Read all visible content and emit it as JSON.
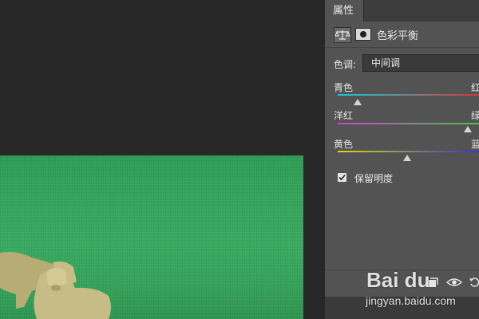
{
  "panel": {
    "tab_label": "属性",
    "title": "色彩平衡",
    "tone": {
      "label": "色调:",
      "value": "中间调"
    },
    "sliders": [
      {
        "left_label": "青色",
        "right_label": "红",
        "value": 0.13,
        "gradient": [
          "#18c8d8",
          "#d83030"
        ]
      },
      {
        "left_label": "洋红",
        "right_label": "绿",
        "value": 0.86,
        "gradient": [
          "#d83cd8",
          "#3ad03a"
        ]
      },
      {
        "left_label": "黄色",
        "right_label": "蓝",
        "value": 0.46,
        "gradient": [
          "#d8d81e",
          "#2a2ad8"
        ]
      }
    ],
    "preserve_luminosity": {
      "label": "保留明度",
      "checked": true
    }
  },
  "watermark": {
    "logo": "Bai du",
    "url": "jingyan.baidu.com"
  },
  "icons": [
    "color-balance-icon",
    "layer-mask-icon",
    "clip-icon",
    "eye-icon",
    "reset-icon"
  ],
  "colors": {
    "panel": "#535353",
    "background": "#282828",
    "grass": "#36a55e"
  }
}
